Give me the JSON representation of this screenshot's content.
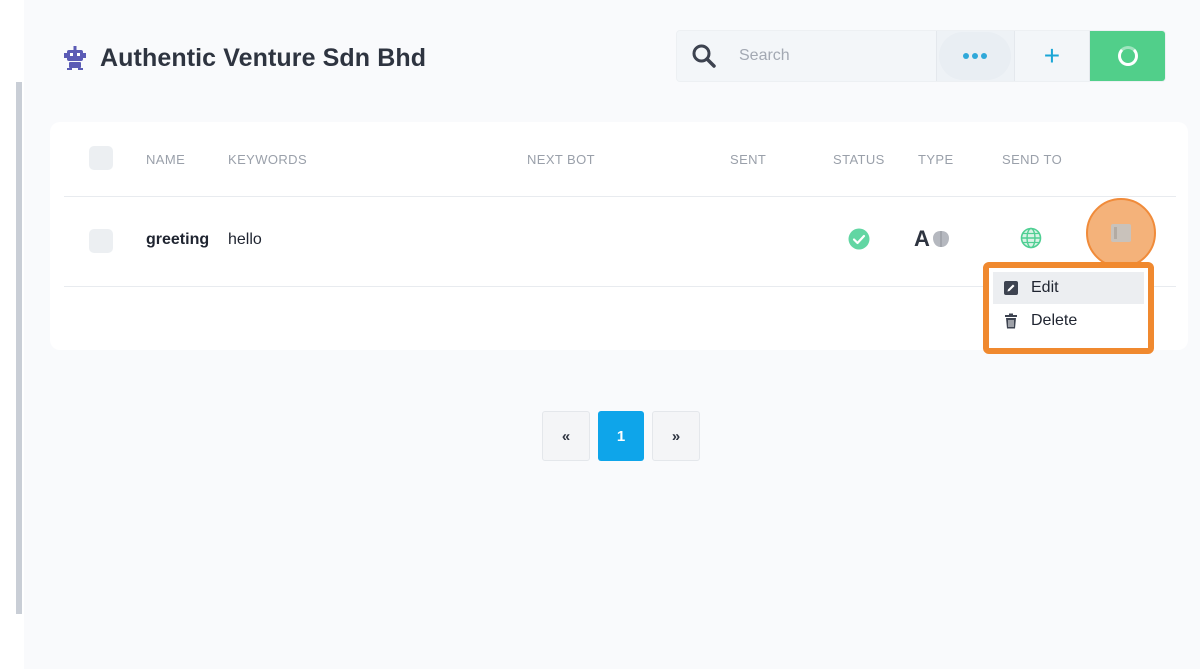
{
  "header": {
    "title": "Authentic Venture Sdn Bhd",
    "icon": "robot-icon"
  },
  "toolbar": {
    "search_placeholder": "Search",
    "search_icon": "search-icon",
    "more_icon": "more-dots-icon",
    "add_label": "+",
    "refresh_icon": "refresh-icon"
  },
  "table": {
    "columns": [
      "NAME",
      "KEYWORDS",
      "NEXT BOT",
      "SENT",
      "STATUS",
      "TYPE",
      "SEND TO"
    ],
    "rows": [
      {
        "name": "greeting",
        "keywords": "hello",
        "next_bot": "",
        "sent": "",
        "status_icon": "check-circle-icon",
        "type_letter": "A",
        "type_icon": "brain-icon",
        "send_to_icon": "globe-icon"
      }
    ]
  },
  "row_menu": {
    "edit_label": "Edit",
    "delete_label": "Delete"
  },
  "pagination": {
    "prev": "«",
    "current": "1",
    "next": "»"
  },
  "colors": {
    "accent_blue": "#0ea5ea",
    "refresh_green": "#51cf8a",
    "highlight_orange": "#f0892f",
    "status_green": "#62d6a3"
  }
}
